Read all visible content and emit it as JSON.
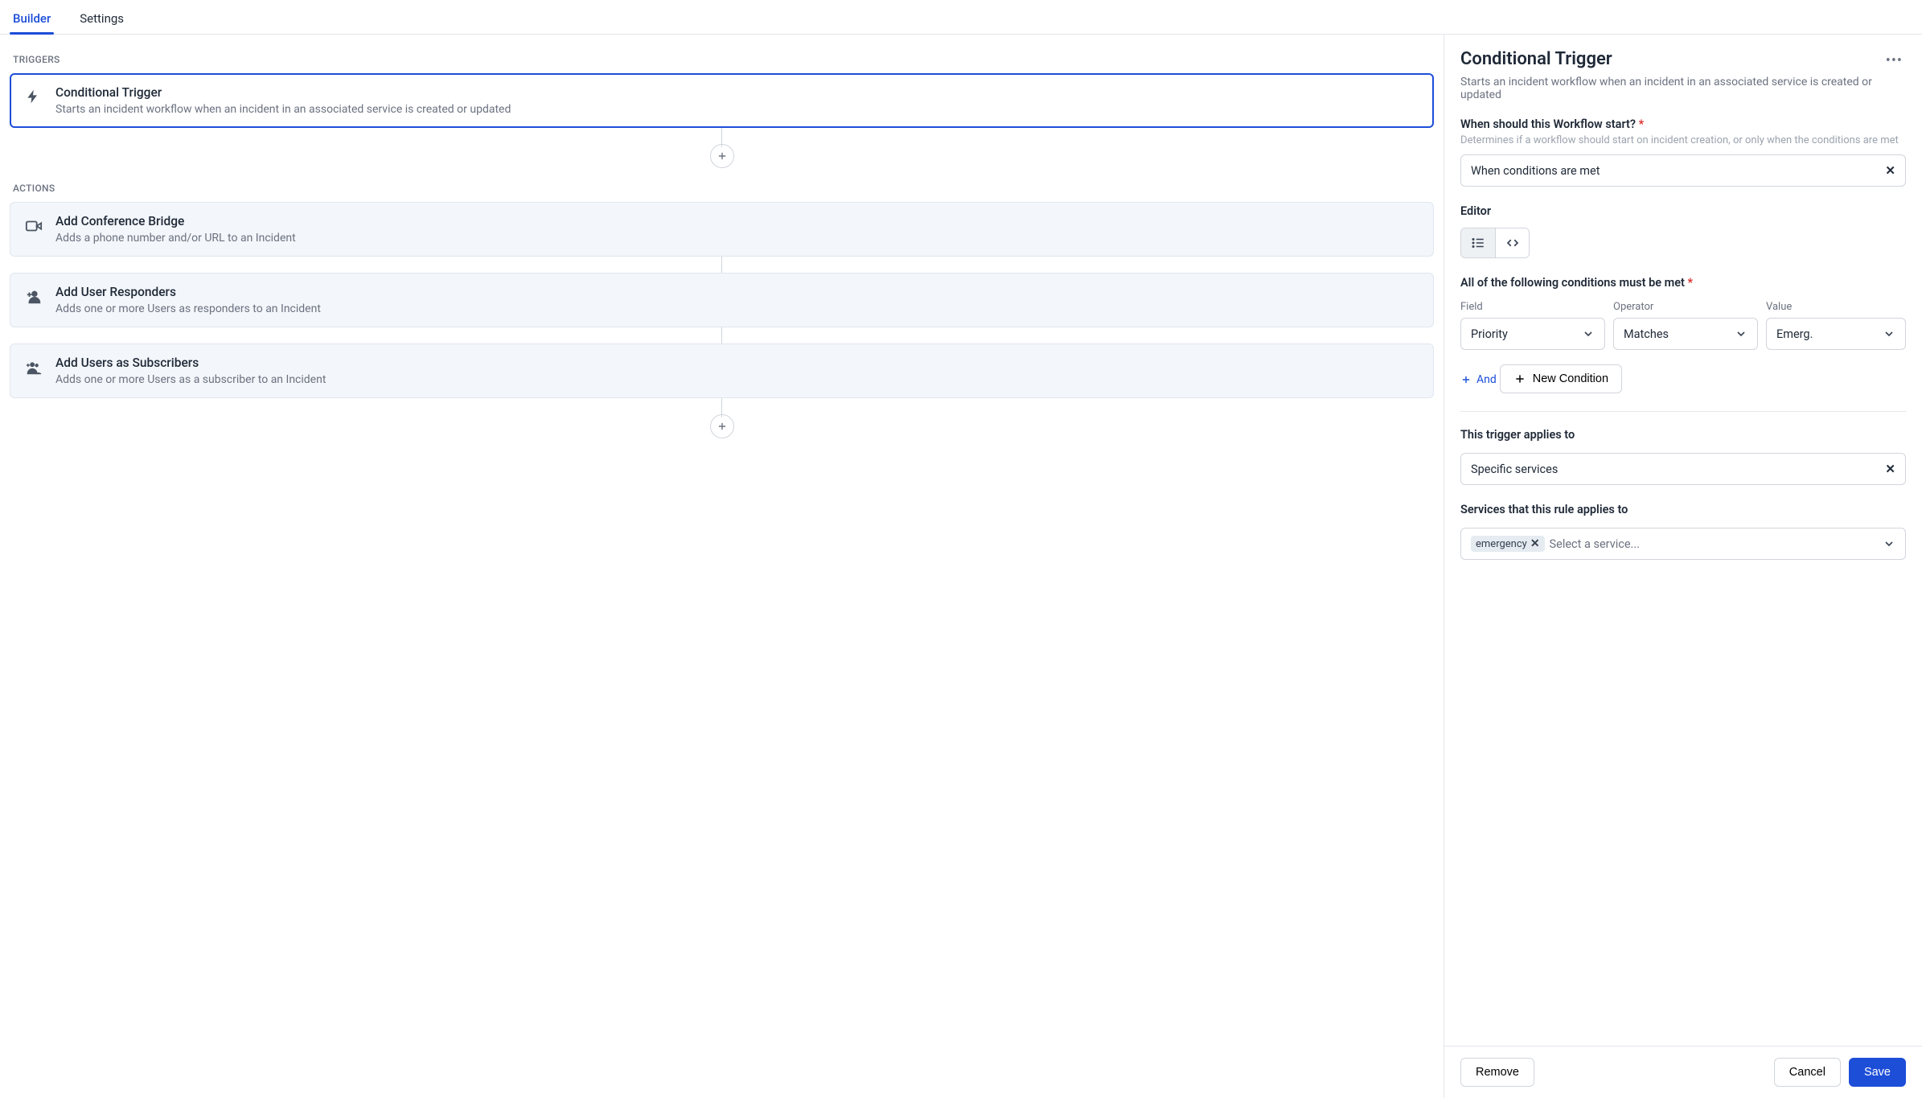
{
  "tabs": {
    "builder": "Builder",
    "settings": "Settings",
    "active": "builder"
  },
  "left": {
    "triggers_label": "TRIGGERS",
    "actions_label": "ACTIONS",
    "trigger_card": {
      "title": "Conditional Trigger",
      "desc": "Starts an incident workflow when an incident in an associated service is created or updated"
    },
    "actions": [
      {
        "icon": "video",
        "title": "Add Conference Bridge",
        "desc": "Adds a phone number and/or URL to an Incident"
      },
      {
        "icon": "user-plus",
        "title": "Add User Responders",
        "desc": "Adds one or more Users as responders to an Incident"
      },
      {
        "icon": "users-plus",
        "title": "Add Users as Subscribers",
        "desc": "Adds one or more Users as a subscriber to an Incident"
      }
    ]
  },
  "right": {
    "title": "Conditional Trigger",
    "subtitle": "Starts an incident workflow when an incident in an associated service is created or updated",
    "when": {
      "label": "When should this Workflow start?",
      "hint": "Determines if a workflow should start on incident creation, or only when the conditions are met",
      "value": "When conditions are met"
    },
    "editor_label": "Editor",
    "conditions": {
      "heading": "All of the following conditions must be met",
      "field_label": "Field",
      "operator_label": "Operator",
      "value_label": "Value",
      "field": "Priority",
      "operator": "Matches",
      "value": "Emerg.",
      "and_label": "And",
      "new_condition": "New Condition"
    },
    "applies": {
      "label": "This trigger applies to",
      "value": "Specific services"
    },
    "services": {
      "label": "Services that this rule applies to",
      "chip": "emergency",
      "placeholder": "Select a service..."
    },
    "buttons": {
      "remove": "Remove",
      "cancel": "Cancel",
      "save": "Save"
    }
  }
}
